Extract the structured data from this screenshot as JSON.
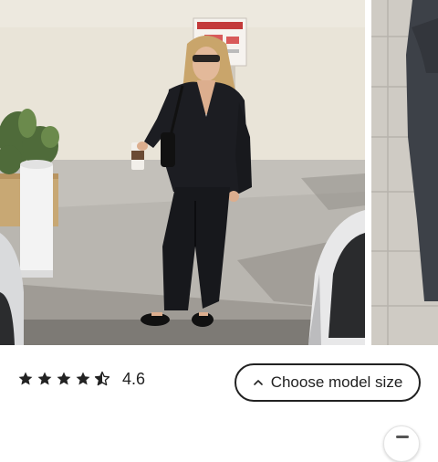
{
  "gallery": {
    "photos": [
      {
        "icon": "product-photo-model-black-suit"
      },
      {
        "icon": "product-photo-detail-partial"
      }
    ]
  },
  "rating": {
    "value": "4.6",
    "stars_filled": 4.6,
    "stars_total": 5
  },
  "size_button": {
    "label": "Choose model size",
    "icon": "chevron-up-icon"
  },
  "colors": {
    "text": "#222222",
    "border": "#222222",
    "background": "#ffffff"
  }
}
